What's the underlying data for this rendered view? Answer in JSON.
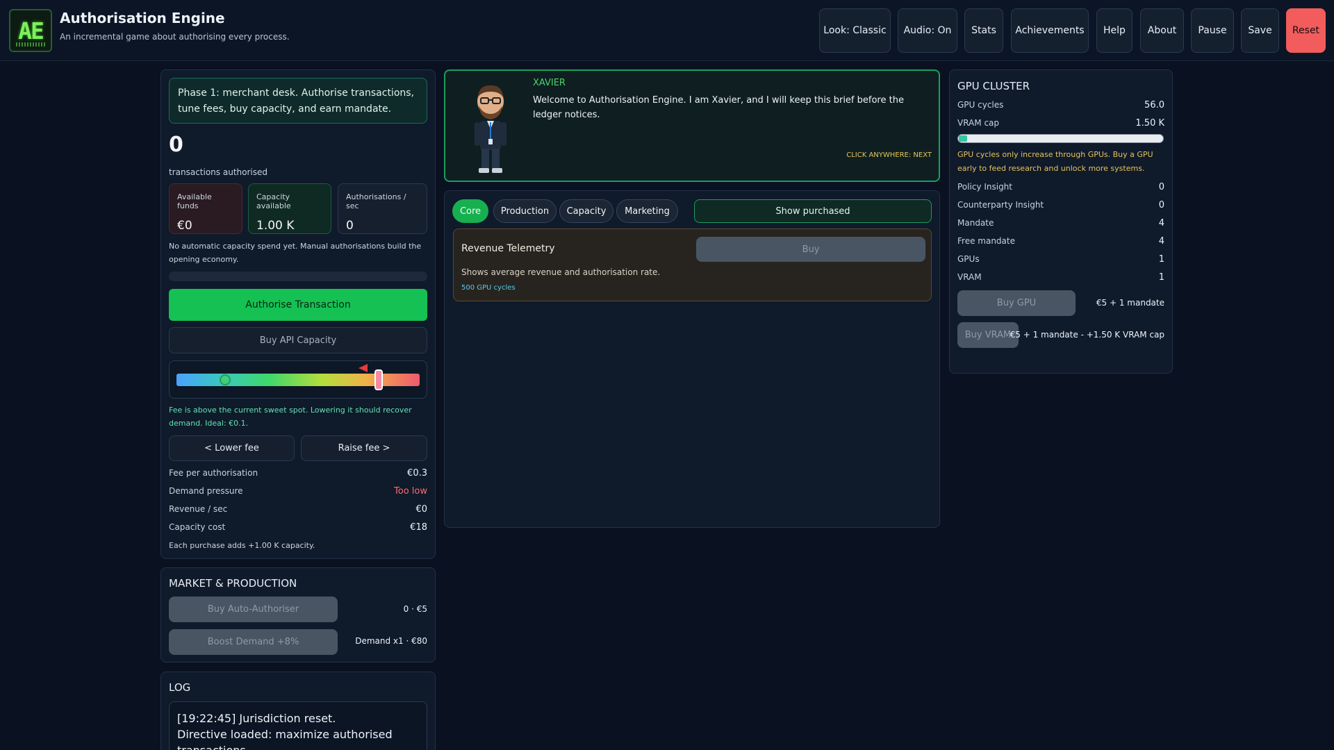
{
  "header": {
    "logo_text": "AE",
    "title": "Authorisation Engine",
    "subtitle": "An incremental game about authorising every process.",
    "buttons": {
      "look": "Look: Classic",
      "audio": "Audio: On",
      "stats": "Stats",
      "achievements": "Achievements",
      "help": "Help",
      "about": "About",
      "pause": "Pause",
      "save": "Save",
      "reset": "Reset"
    }
  },
  "left": {
    "phase_text": "Phase 1: merchant desk. Authorise transactions, tune fees, buy capacity, and earn mandate.",
    "count": "0",
    "count_label": "transactions authorised",
    "cards": {
      "funds_label": "Available funds",
      "funds_value": "€0",
      "capacity_label": "Capacity available",
      "capacity_value": "1.00 K",
      "rate_label": "Authorisations / sec",
      "rate_value": "0"
    },
    "spend_note": "No automatic capacity spend yet. Manual authorisations build the opening economy.",
    "authorise_button": "Authorise Transaction",
    "buy_capacity_button": "Buy API Capacity",
    "fee_level": 0.83,
    "sweet_spot_level": 0.2,
    "fee_note": "Fee is above the current sweet spot. Lowering it should recover demand. Ideal: €0.1.",
    "lower_fee": "< Lower fee",
    "raise_fee": "Raise fee >",
    "stats": {
      "fee_label": "Fee per authorisation",
      "fee_value": "€0.3",
      "demand_label": "Demand pressure",
      "demand_value": "Too low",
      "revenue_label": "Revenue / sec",
      "revenue_value": "€0",
      "capcost_label": "Capacity cost",
      "capcost_value": "€18"
    },
    "purchase_note": "Each purchase adds +1.00 K capacity."
  },
  "market": {
    "title": "MARKET & PRODUCTION",
    "auto_button": "Buy Auto-Authoriser",
    "auto_info": "0 · €5",
    "boost_button": "Boost Demand +8%",
    "boost_info": "Demand x1 · €80"
  },
  "log": {
    "title": "LOG",
    "line1": "[19:22:45] Jurisdiction reset.",
    "line2": "Directive loaded: maximize authorised transactions."
  },
  "dialog": {
    "speaker": "XAVIER",
    "text": "Welcome to Authorisation Engine. I am Xavier, and I will keep this brief before the ledger notices.",
    "hint": "CLICK ANYWHERE: NEXT"
  },
  "tabs": {
    "core": "Core",
    "production": "Production",
    "capacity": "Capacity",
    "marketing": "Marketing",
    "show_purchased": "Show purchased"
  },
  "upgrade": {
    "name": "Revenue Telemetry",
    "desc": "Shows average revenue and authorisation rate.",
    "cost": "500 GPU cycles",
    "buy": "Buy"
  },
  "gpu": {
    "title": "GPU CLUSTER",
    "cycles_label": "GPU cycles",
    "cycles_value": "56.0",
    "vram_label": "VRAM cap",
    "vram_value": "1.50 K",
    "vram_fill": 0.04,
    "note": "GPU cycles only increase through GPUs. Buy a GPU early to feed research and unlock more systems.",
    "policy_label": "Policy Insight",
    "policy_value": "0",
    "counterparty_label": "Counterparty Insight",
    "counterparty_value": "0",
    "mandate_label": "Mandate",
    "mandate_value": "4",
    "free_mandate_label": "Free mandate",
    "free_mandate_value": "4",
    "gpus_label": "GPUs",
    "gpus_value": "1",
    "vram_count_label": "VRAM",
    "vram_count_value": "1",
    "buy_gpu": "Buy GPU",
    "buy_gpu_cost": "€5 + 1 mandate",
    "buy_vram": "Buy VRAM",
    "buy_vram_cost": "€5 + 1 mandate - +1.50 K VRAM cap"
  },
  "colors": {
    "accent_green": "#15c153",
    "danger": "#f25c5c",
    "warning": "#e7c45a",
    "info": "#5fcaea"
  }
}
